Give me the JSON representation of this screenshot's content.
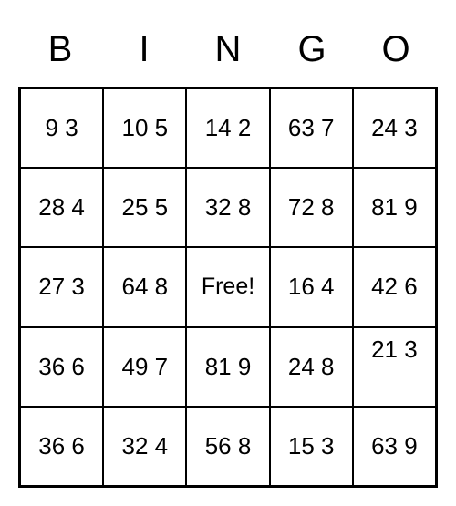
{
  "bingo": {
    "headers": [
      "B",
      "I",
      "N",
      "G",
      "O"
    ],
    "grid": [
      [
        "9 3",
        "10 5",
        "14 2",
        "63 7",
        "24 3"
      ],
      [
        "28 4",
        "25 5",
        "32 8",
        "72 8",
        "81 9"
      ],
      [
        "27 3",
        "64 8",
        "Free!",
        "16 4",
        "42 6"
      ],
      [
        "36 6",
        "49 7",
        "81 9",
        "24 8",
        "21 3"
      ],
      [
        "36 6",
        "32 4",
        "56 8",
        "15 3",
        "63 9"
      ]
    ]
  }
}
